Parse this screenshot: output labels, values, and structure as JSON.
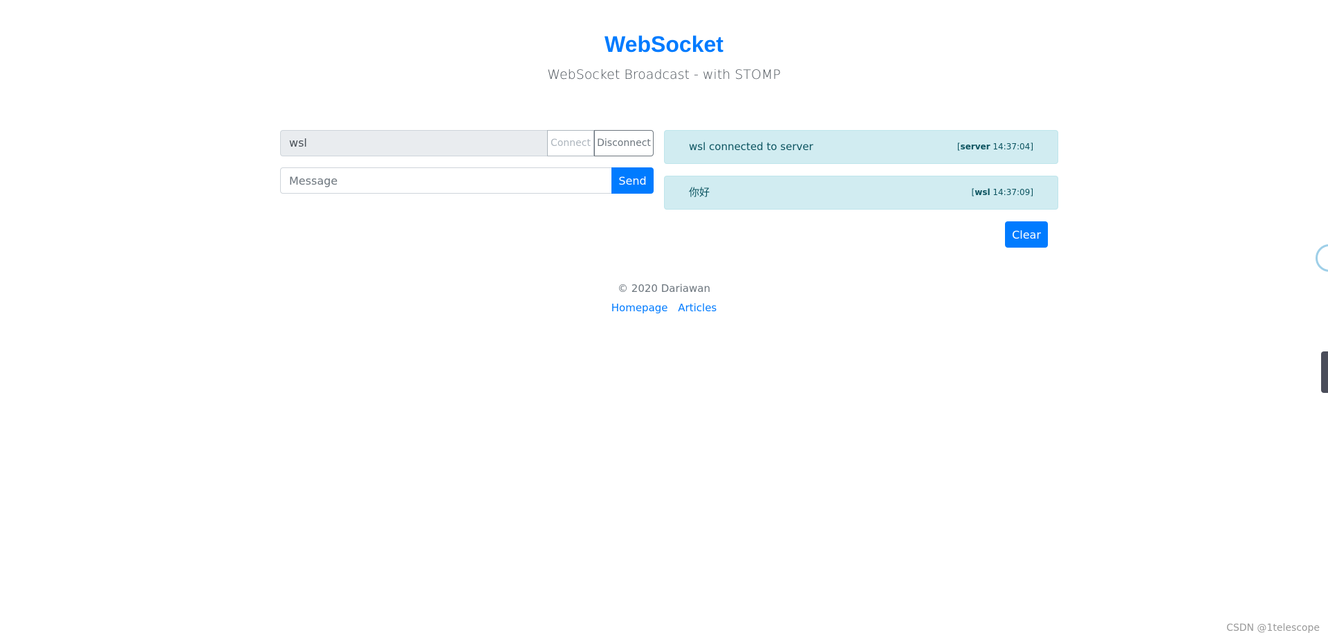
{
  "header": {
    "title": "WebSocket",
    "subtitle": "WebSocket Broadcast - with STOMP"
  },
  "controls": {
    "name_value": "wsl",
    "connect_label": "Connect",
    "disconnect_label": "Disconnect",
    "message_placeholder": "Message",
    "send_label": "Send"
  },
  "messages": [
    {
      "text": "wsl connected to server",
      "sender": "server",
      "time": "14:37:04"
    },
    {
      "text": "你好",
      "sender": "wsl",
      "time": "14:37:09"
    }
  ],
  "clear_label": "Clear",
  "footer": {
    "copyright": "© 2020 Dariawan",
    "links": [
      "Homepage",
      "Articles"
    ]
  },
  "watermark": "CSDN @1telescope",
  "colors": {
    "primary": "#007bff",
    "alert_bg": "#d1ecf1",
    "alert_text": "#0c5460"
  }
}
